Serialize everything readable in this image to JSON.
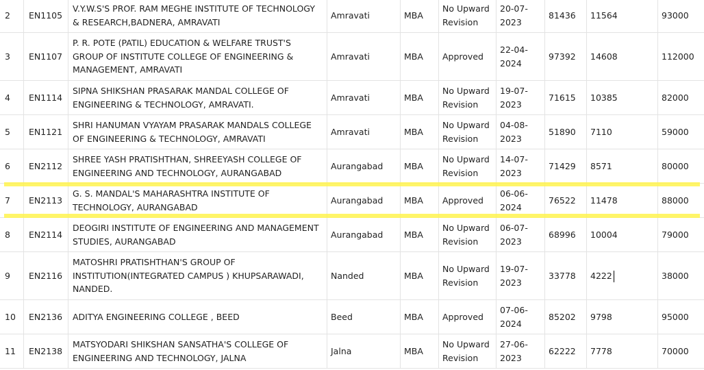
{
  "rows": [
    {
      "sr": "2",
      "code": "EN1105",
      "name": "V.Y.W.S'S PROF. RAM MEGHE INSTITUTE OF TECHNOLOGY & RESEARCH,BADNERA, AMRAVATI",
      "district": "Amravati",
      "course": "MBA",
      "status": "No Upward Revision",
      "date": "20-07-2023",
      "v1": "81436",
      "v2": "11564",
      "v3": "93000"
    },
    {
      "sr": "3",
      "code": "EN1107",
      "name": "P. R. POTE (PATIL) EDUCATION & WELFARE TRUST'S GROUP OF INSTITUTE COLLEGE OF ENGINEERING & MANAGEMENT, AMRAVATI",
      "district": "Amravati",
      "course": "MBA",
      "status": "Approved",
      "date": "22-04-2024",
      "v1": "97392",
      "v2": "14608",
      "v3": "112000"
    },
    {
      "sr": "4",
      "code": "EN1114",
      "name": "SIPNA SHIKSHAN PRASARAK MANDAL COLLEGE OF ENGINEERING & TECHNOLOGY, AMRAVATI.",
      "district": "Amravati",
      "course": "MBA",
      "status": "No Upward Revision",
      "date": "19-07-2023",
      "v1": "71615",
      "v2": "10385",
      "v3": "82000"
    },
    {
      "sr": "5",
      "code": "EN1121",
      "name": "SHRI HANUMAN VYAYAM PRASARAK MANDALS COLLEGE OF ENGINEERING & TECHNOLOGY, AMRAVATI",
      "district": "Amravati",
      "course": "MBA",
      "status": "No Upward Revision",
      "date": "04-08-2023",
      "v1": "51890",
      "v2": "7110",
      "v3": "59000"
    },
    {
      "sr": "6",
      "code": "EN2112",
      "name": "SHREE YASH PRATISHTHAN, SHREEYASH COLLEGE OF ENGINEERING AND TECHNOLOGY, AURANGABAD",
      "district": "Aurangabad",
      "course": "MBA",
      "status": "No Upward Revision",
      "date": "14-07-2023",
      "v1": "71429",
      "v2": "8571",
      "v3": "80000"
    },
    {
      "sr": "7",
      "code": "EN2113",
      "name": "G. S. MANDAL'S MAHARASHTRA INSTITUTE OF TECHNOLOGY, AURANGABAD",
      "district": "Aurangabad",
      "course": "MBA",
      "status": "Approved",
      "date": "06-06-2024",
      "v1": "76522",
      "v2": "11478",
      "v3": "88000"
    },
    {
      "sr": "8",
      "code": "EN2114",
      "name": "DEOGIRI INSTITUTE OF ENGINEERING AND MANAGEMENT STUDIES, AURANGABAD",
      "district": "Aurangabad",
      "course": "MBA",
      "status": "No Upward Revision",
      "date": "06-07-2023",
      "v1": "68996",
      "v2": "10004",
      "v3": "79000"
    },
    {
      "sr": "9",
      "code": "EN2116",
      "name": "MATOSHRI PRATISHTHAN'S GROUP OF INSTITUTION(INTEGRATED CAMPUS ) KHUPSARAWADI, NANDED.",
      "district": "Nanded",
      "course": "MBA",
      "status": "No Upward Revision",
      "date": "19-07-2023",
      "v1": "33778",
      "v2": "4222",
      "v3": "38000"
    },
    {
      "sr": "10",
      "code": "EN2136",
      "name": "ADITYA ENGINEERING COLLEGE , BEED",
      "district": "Beed",
      "course": "MBA",
      "status": "Approved",
      "date": "07-06-2024",
      "v1": "85202",
      "v2": "9798",
      "v3": "95000"
    },
    {
      "sr": "11",
      "code": "EN2138",
      "name": "MATSYODARI SHIKSHAN SANSATHA'S COLLEGE OF ENGINEERING AND TECHNOLOGY, JALNA",
      "district": "Jalna",
      "course": "MBA",
      "status": "No Upward Revision",
      "date": "27-06-2023",
      "v1": "62222",
      "v2": "7778",
      "v3": "70000"
    }
  ],
  "highlight_color": "#fff34d"
}
